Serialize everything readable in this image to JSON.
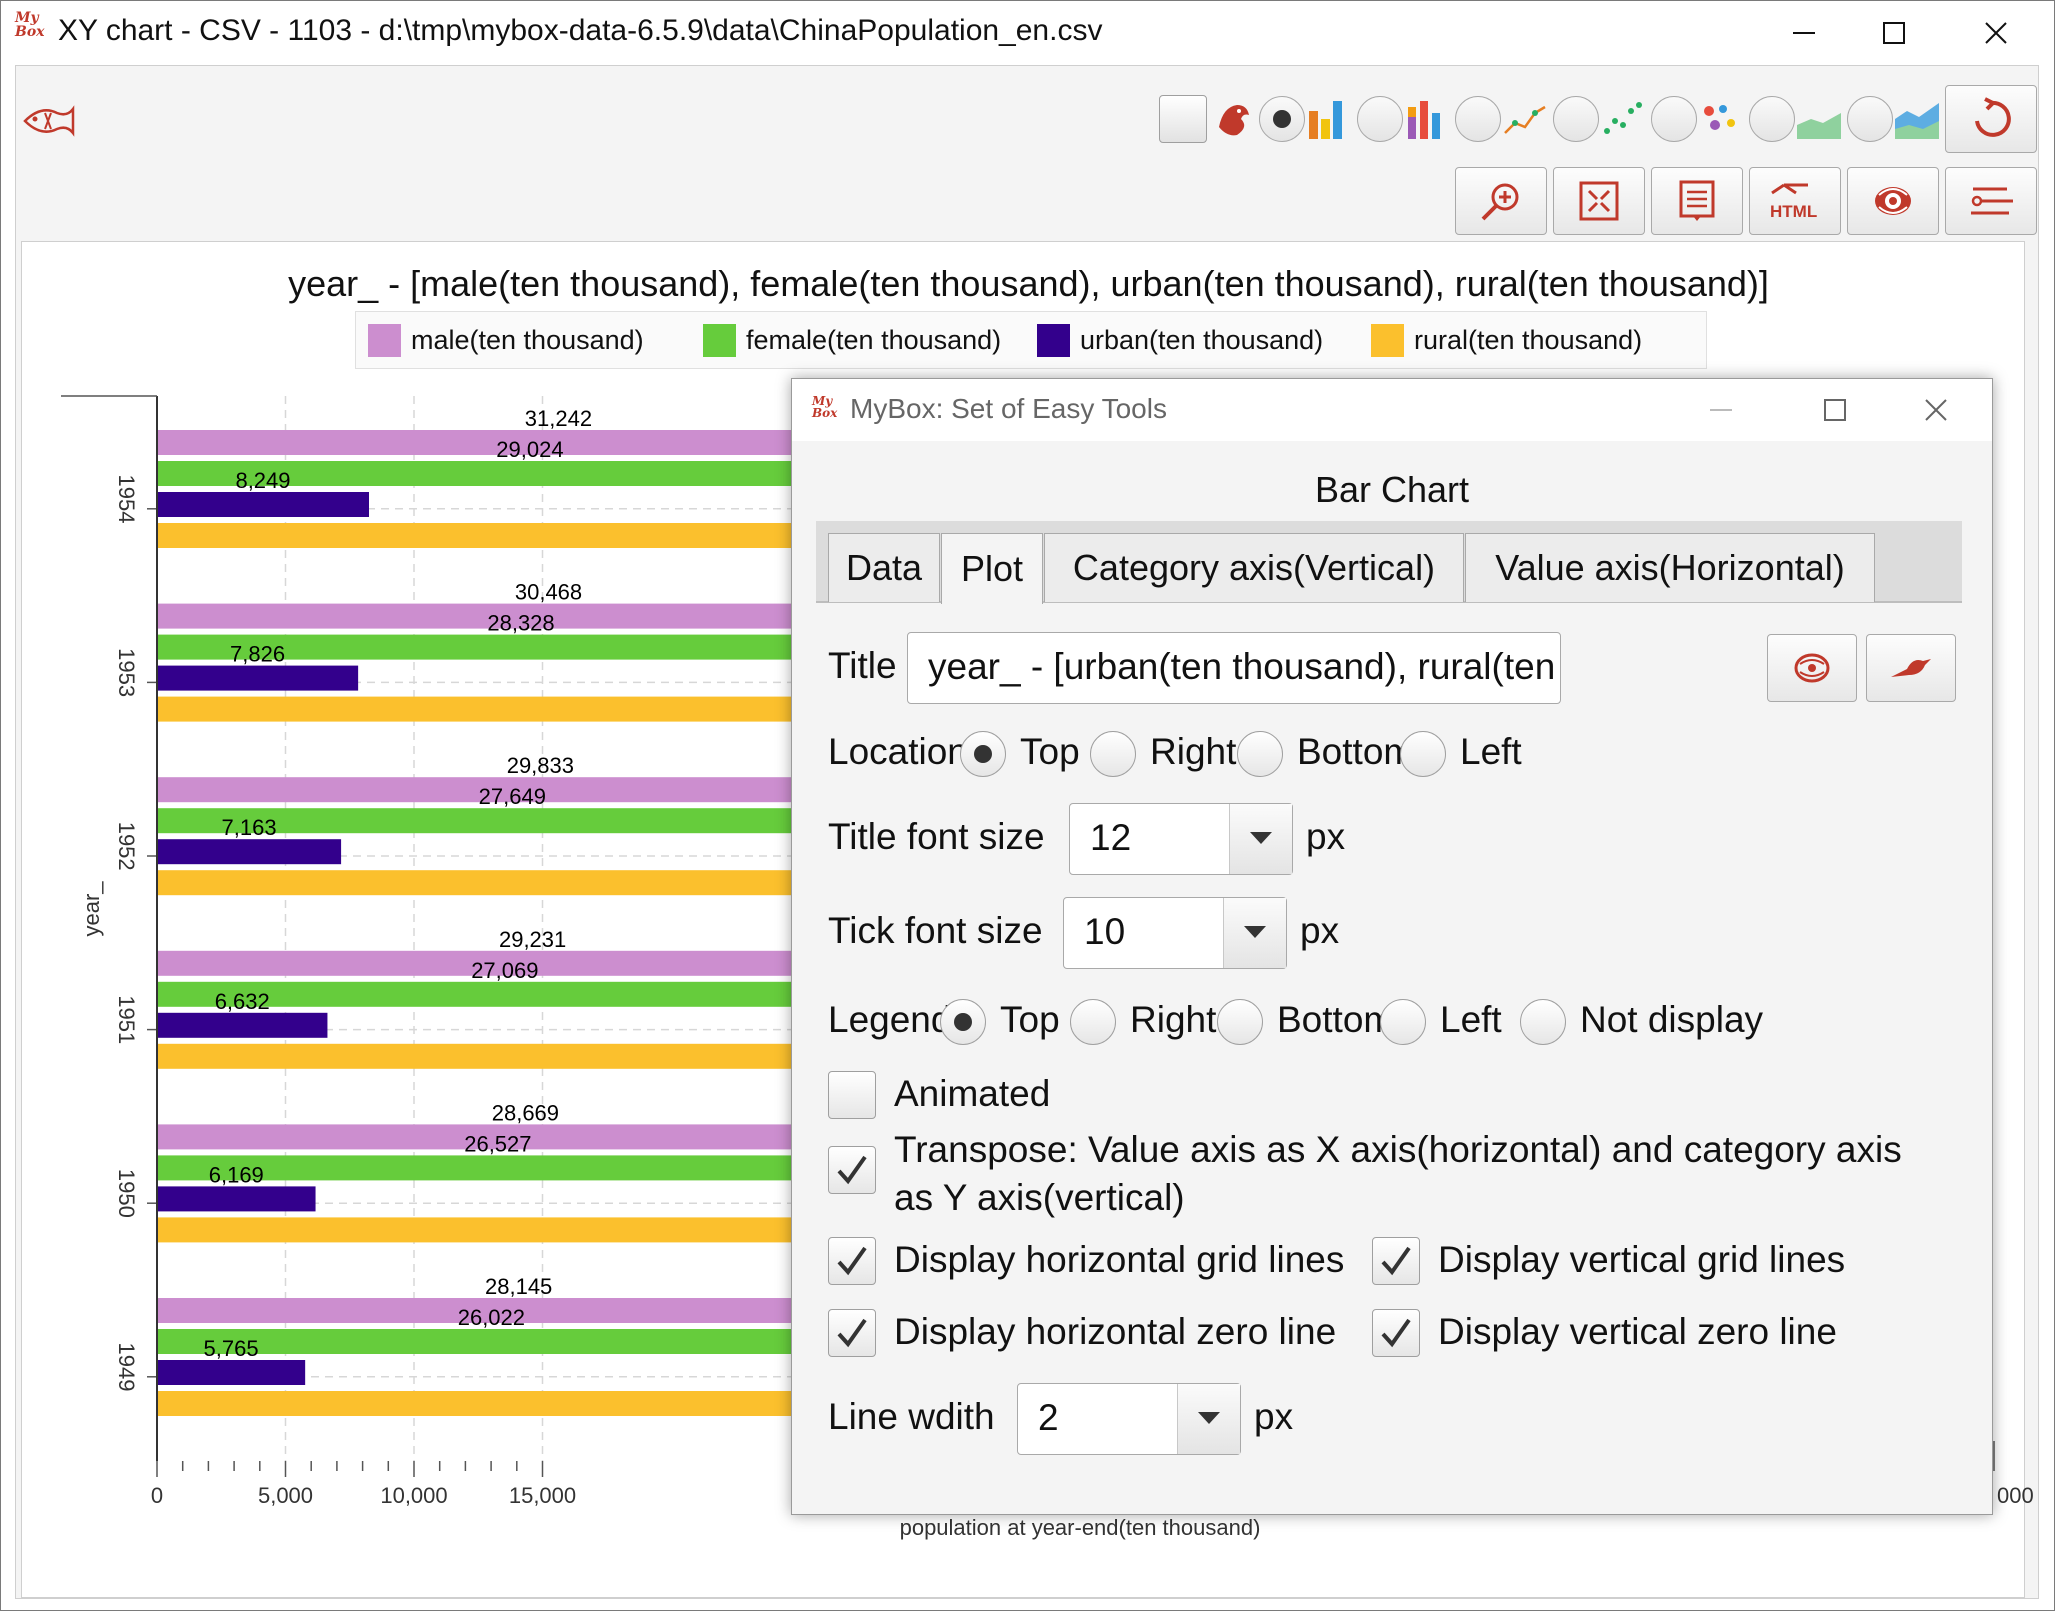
{
  "window": {
    "title": "XY chart - CSV - 1103 - d:\\tmp\\mybox-data-6.5.9\\data\\ChinaPopulation_en.csv",
    "logo": "My Box",
    "controls": [
      "minimize-icon",
      "maximize-icon",
      "close-icon"
    ]
  },
  "toolbar": {
    "chart_types": [
      "bar-chart-icon",
      "stacked-bar-icon",
      "line-chart-icon",
      "scatter-icon",
      "bubble-icon",
      "area-chart-icon",
      "stacked-area-icon"
    ],
    "buttons": [
      "zoom-in-icon",
      "fit-icon",
      "data-icon",
      "html-icon",
      "style-icon",
      "menu-icon"
    ],
    "refresh_icon": "refresh-icon"
  },
  "chart_data": {
    "type": "bar",
    "orientation": "horizontal",
    "title": "year_ - [male(ten thousand), female(ten thousand), urban(ten thousand), rural(ten thousand)]",
    "ylabel": "year_",
    "xlabel": "population at year-end(ten thousand)",
    "categories": [
      "1954",
      "1953",
      "1952",
      "1951",
      "1950",
      "1949"
    ],
    "series": [
      {
        "name": "male(ten thousand)",
        "color": "#cc8ecf",
        "values": [
          31242,
          30468,
          29833,
          29231,
          28669,
          28145
        ]
      },
      {
        "name": "female(ten thousand)",
        "color": "#66cc3c",
        "values": [
          29024,
          28328,
          27649,
          27069,
          26527,
          26022
        ]
      },
      {
        "name": "urban(ten thousand)",
        "color": "#33008c",
        "values": [
          8249,
          7826,
          7163,
          6632,
          6169,
          5765
        ]
      },
      {
        "name": "rural(ten thousand)",
        "color": "#fbc02d",
        "values": [
          null,
          null,
          null,
          null,
          null,
          null
        ]
      }
    ],
    "data_labels": [
      [
        "31,242",
        "30,468",
        "29,833",
        "29,231",
        "28,669",
        "28,145"
      ],
      [
        "29,024",
        "28,328",
        "27,649",
        "27,069",
        "26,527",
        "26,022"
      ],
      [
        "8,249",
        "7,826",
        "7,163",
        "6,632",
        "6,169",
        "5,765"
      ]
    ],
    "xticks": [
      "0",
      "5,000",
      "10,000",
      "15,000"
    ],
    "xtick_right_partial": "000",
    "xlim": [
      0,
      55000
    ],
    "legend_position": "top",
    "grid": true
  },
  "dialog": {
    "title": "MyBox: Set of Easy Tools",
    "heading": "Bar Chart",
    "tabs": [
      {
        "label": "Data",
        "selected": false
      },
      {
        "label": "Plot",
        "selected": true
      },
      {
        "label": "Category axis(Vertical)",
        "selected": false
      },
      {
        "label": "Value axis(Horizontal)",
        "selected": false
      }
    ],
    "title_label": "Title",
    "title_value": "year_ - [urban(ten thousand), rural(ten thousand)]",
    "location_label": "Location",
    "location_options": [
      "Top",
      "Right",
      "Bottom",
      "Left"
    ],
    "location_selected": "Top",
    "title_font_label": "Title font size",
    "title_font_value": "12",
    "tick_font_label": "Tick font size",
    "tick_font_value": "10",
    "px": "px",
    "legend_label": "Legend",
    "legend_options": [
      "Top",
      "Right",
      "Bottom",
      "Left",
      "Not display"
    ],
    "legend_selected": "Top",
    "animated_label": "Animated",
    "animated": false,
    "transpose_line1": "Transpose: Value axis as X axis(horizontal) and category axis",
    "transpose_line2": "as Y axis(vertical)",
    "transpose": true,
    "hgrid_label": "Display horizontal grid lines",
    "vgrid_label": "Display vertical grid lines",
    "hzero_label": "Display horizontal zero line",
    "vzero_label": "Display vertical zero line",
    "line_width_label": "Line wdith",
    "line_width_value": "2"
  }
}
